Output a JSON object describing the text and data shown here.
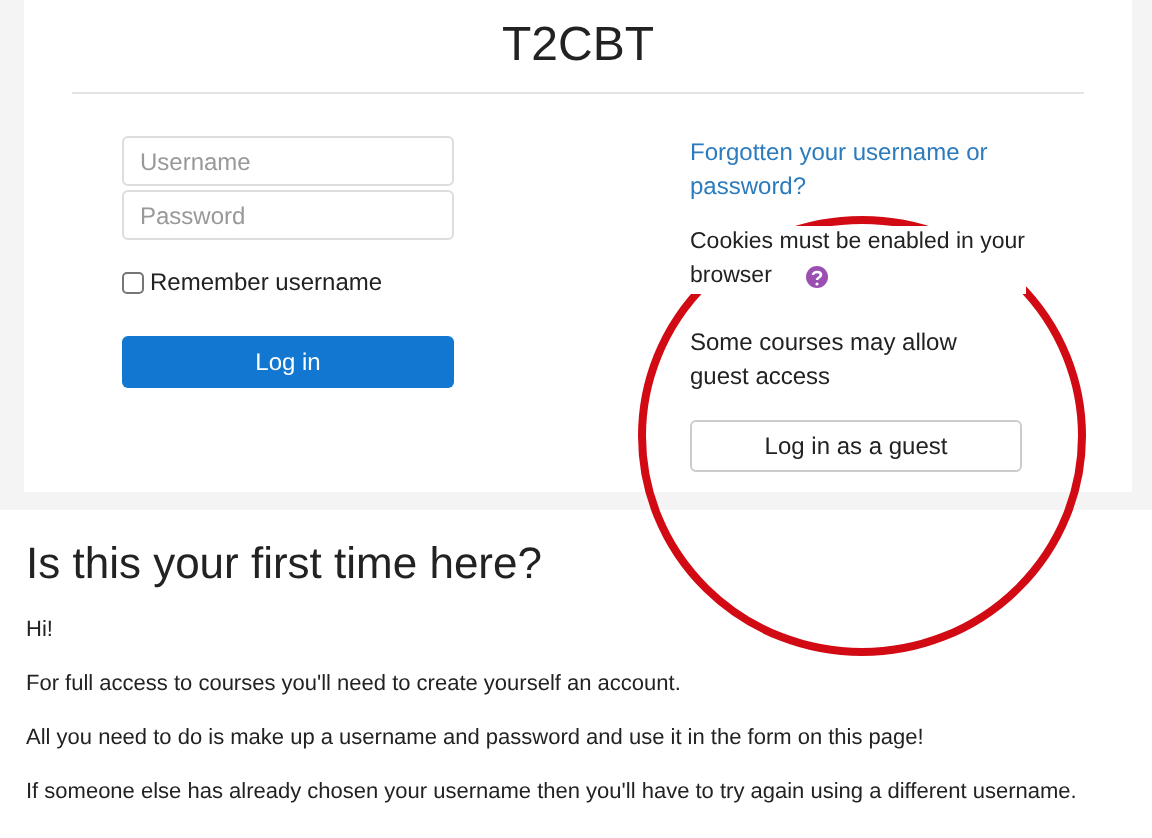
{
  "site_title": "T2CBT",
  "login_form": {
    "username": {
      "placeholder": "Username"
    },
    "password": {
      "placeholder": "Password"
    },
    "remember": {
      "label": "Remember username",
      "checked": false
    },
    "submit": "Log in"
  },
  "side": {
    "forgot_link": "Forgotten your username or password?",
    "cookies_note": "Cookies must be enabled in your browser",
    "guest_note": "Some courses may allow guest access",
    "guest_button": "Log in as a guest"
  },
  "annotation": {
    "kind": "circle"
  },
  "first_time": {
    "heading": "Is this your first time here?",
    "paragraphs": [
      "Hi!",
      "For full access to courses you'll need to create yourself an account.",
      "All you need to do is make up a username and password and use it in the form on this page!",
      "If someone else has already chosen your username then you'll have to try again using a different username."
    ]
  }
}
